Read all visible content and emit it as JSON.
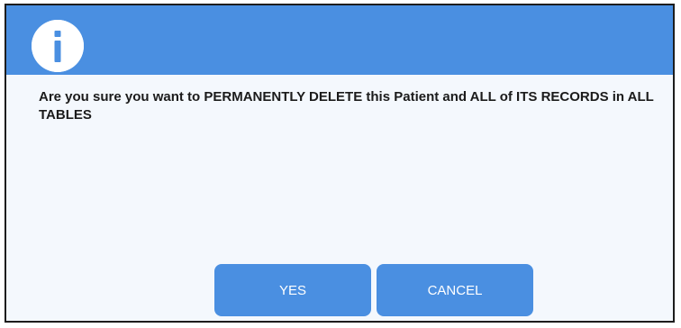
{
  "dialog": {
    "icon": "info-icon",
    "header_color": "#4a8fe1",
    "body_color": "#f4f8fd",
    "message": "Are you sure you want to PERMANENTLY DELETE this Patient and ALL of ITS RECORDS in ALL TABLES",
    "buttons": {
      "yes_label": "YES",
      "cancel_label": "CANCEL"
    },
    "button_color": "#4a8fe1"
  }
}
